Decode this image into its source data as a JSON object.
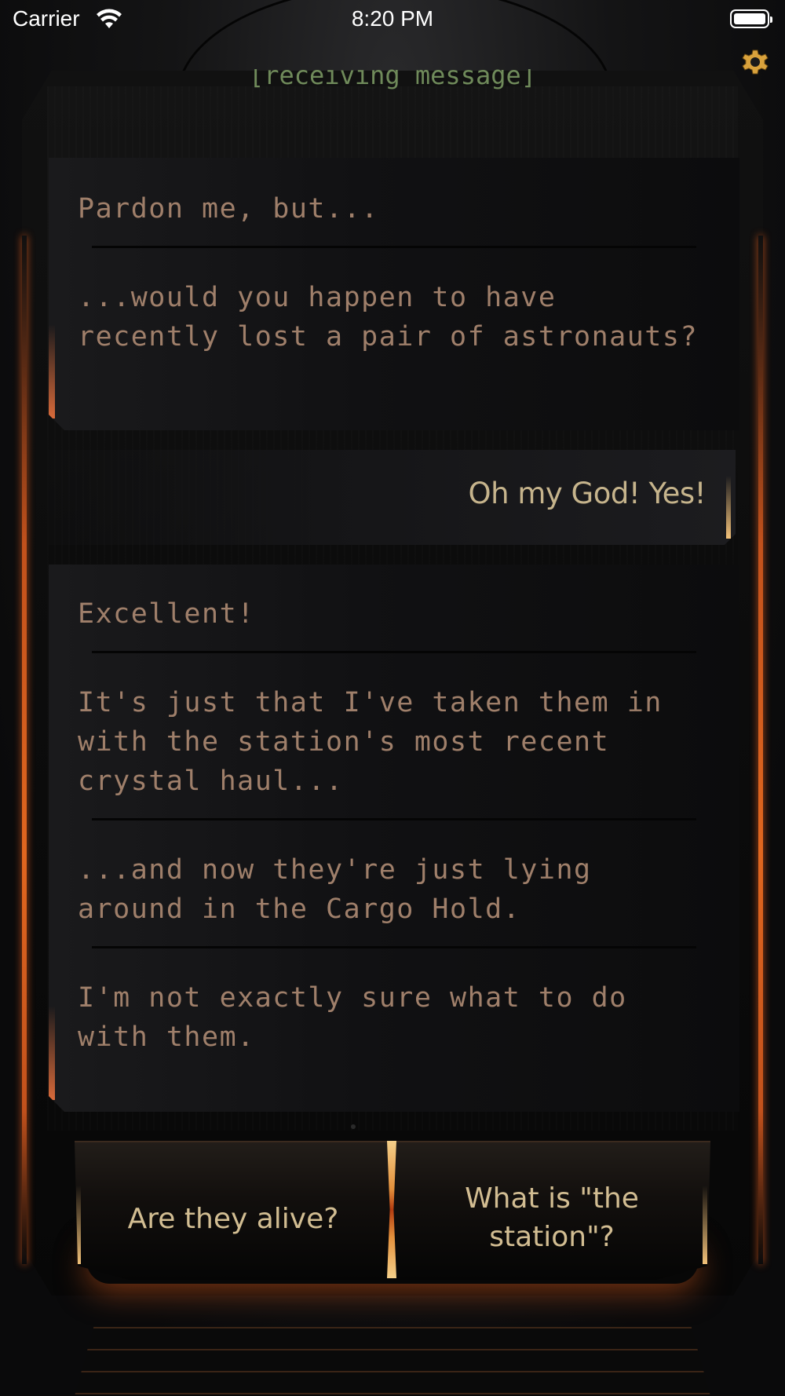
{
  "status_bar": {
    "carrier": "Carrier",
    "time": "8:20 PM"
  },
  "header": {
    "receiving_label": "[receiving message]"
  },
  "messages": [
    {
      "speaker": "incoming",
      "paragraphs": [
        "Pardon me, but...",
        "...would you happen to have recently lost a pair of astronauts?"
      ]
    },
    {
      "speaker": "player",
      "text": "Oh my God! Yes!"
    },
    {
      "speaker": "incoming",
      "paragraphs": [
        "Excellent!",
        "It's just that I've taken them in with the station's most recent crystal haul...",
        "...and now they're just lying around in the Cargo Hold.",
        "I'm not exactly sure what to do with them."
      ]
    }
  ],
  "choices": {
    "left": "Are they alive?",
    "right": "What is \"the station\"?"
  },
  "colors": {
    "accent_orange": "#d86a3a",
    "text_mono": "#9f7f6a",
    "text_choice": "#d2bd92",
    "gear": "#d9a23c"
  },
  "icons": [
    "wifi-icon",
    "battery-icon",
    "gear-icon"
  ]
}
